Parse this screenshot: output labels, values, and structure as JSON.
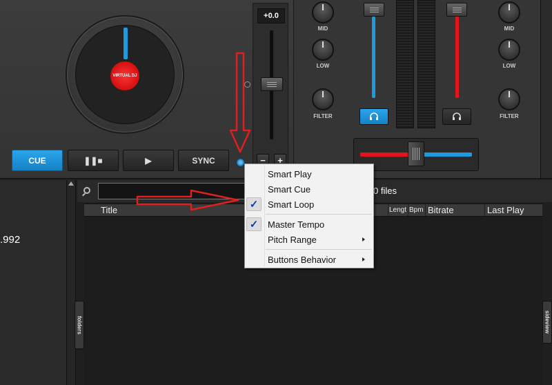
{
  "deck": {
    "logo_text": "VIRTUAL DJ",
    "cue_label": "CUE",
    "pause_label": "❚❚■",
    "play_label": "▶",
    "sync_label": "SYNC",
    "pitch_value": "+0.0",
    "pitch_minus": "−",
    "pitch_plus": "+",
    "accent_color": "#1e9be0"
  },
  "mixer": {
    "left_labels": {
      "mid": "MID",
      "low": "LOW",
      "filter": "FILTER"
    },
    "right_labels": {
      "mid": "MID",
      "low": "LOW",
      "filter": "FILTER"
    },
    "left_channel_color": "#1e9be0",
    "right_channel_color": "#e4151a",
    "headphone_icon_left": "headphones-icon",
    "headphone_icon_right": "headphones-icon"
  },
  "browser": {
    "left_value": ".992",
    "search_value": "",
    "files_text": "0 files",
    "columns": [
      "Title",
      "Lengt",
      "Bpm",
      "Bitrate",
      "Last Play"
    ],
    "tab_folders": "folders",
    "tab_sideview": "sideview"
  },
  "context_menu": {
    "items": [
      {
        "label": "Smart Play",
        "checked": false,
        "submenu": false
      },
      {
        "label": "Smart Cue",
        "checked": false,
        "submenu": false
      },
      {
        "label": "Smart Loop",
        "checked": true,
        "submenu": false
      },
      {
        "label": "Master Tempo",
        "checked": true,
        "submenu": false
      },
      {
        "label": "Pitch Range",
        "checked": false,
        "submenu": true
      },
      {
        "label": "Buttons Behavior",
        "checked": false,
        "submenu": true
      }
    ],
    "check_glyph": "✓"
  },
  "annotations": {
    "arrow_color": "#e02020"
  }
}
